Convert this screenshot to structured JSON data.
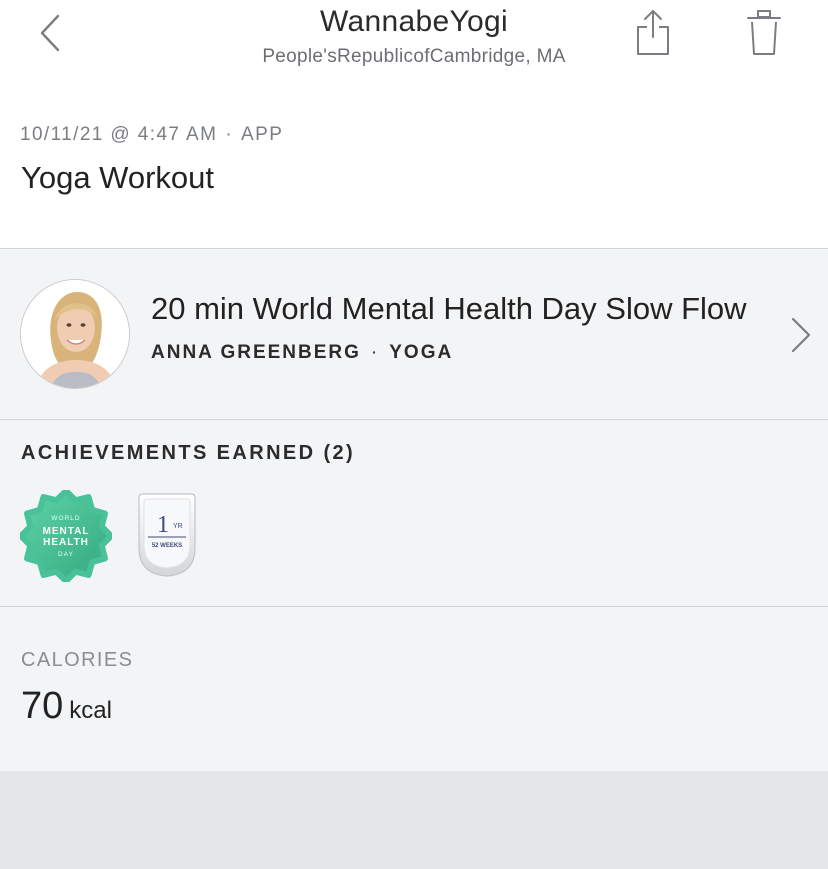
{
  "header": {
    "user_name": "WannabeYogi",
    "location": "People'sRepublicofCambridge, MA",
    "icons": {
      "back": "chevron-left-icon",
      "share": "share-icon",
      "delete": "trash-icon"
    }
  },
  "workout": {
    "timestamp": "10/11/21 @ 4:47 AM",
    "separator": "·",
    "source": "APP",
    "title": "Yoga Workout"
  },
  "class_info": {
    "title": "20 min World Mental Health Day Slow Flow",
    "instructor": "ANNA GREENBERG",
    "separator": "·",
    "category": "YOGA",
    "icon": "chevron-right-icon"
  },
  "achievements": {
    "heading": "ACHIEVEMENTS EARNED (2)",
    "badges": [
      {
        "name": "world-mental-health-day-badge",
        "lines": [
          "WORLD",
          "MENTAL",
          "HEALTH",
          "DAY"
        ],
        "color": "#49c29a"
      },
      {
        "name": "one-year-badge",
        "big": "1",
        "unit": "YR",
        "sub": "52 WEEKS",
        "color": "#3c4c7a"
      }
    ]
  },
  "calories": {
    "label": "CALORIES",
    "value": "70",
    "unit": "kcal"
  },
  "colors": {
    "header_bg": "#ffffff",
    "section_bg": "#f3f4f6",
    "footer_bg": "#e5e6e9",
    "badge_green": "#49c29a",
    "badge_navy": "#3c4c7a"
  }
}
